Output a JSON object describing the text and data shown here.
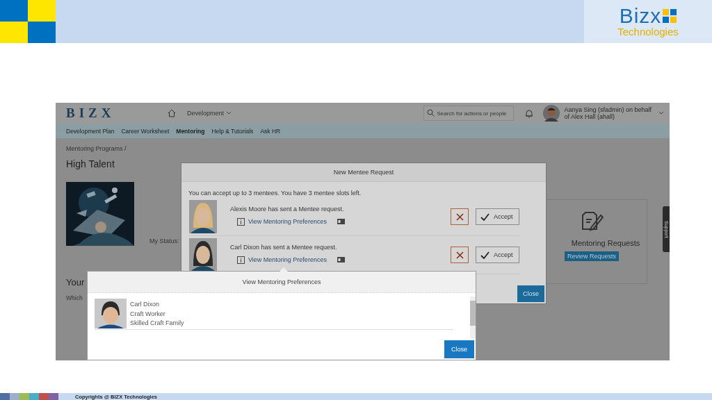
{
  "slide": {
    "logo": {
      "name": "Bizx",
      "tagline": "Technologies"
    },
    "footer": "Copyrights @ BIZX Technologies"
  },
  "app": {
    "logo": "BIZX",
    "module": "Development",
    "search": {
      "placeholder": "Search for actions or people"
    },
    "user": [
      "Aanya Sing (sfadmin) on behalf",
      "of Alex Hall (ahall)"
    ],
    "nav": [
      {
        "label": "Development Plan",
        "selected": false
      },
      {
        "label": "Career Worksheet",
        "selected": false
      },
      {
        "label": "Mentoring",
        "selected": true
      },
      {
        "label": "Help & Tutorials",
        "selected": false
      },
      {
        "label": "Ask HR",
        "selected": false
      }
    ],
    "breadcrumb": "Mentoring Programs /",
    "title": "High Talent",
    "status_label": "My Status:",
    "section_heading": "Your",
    "section_text": "Which",
    "card": {
      "title": "Mentoring Requests",
      "button": "Review Requests"
    },
    "side_tab": "Support"
  },
  "mentee_dialog": {
    "title": "New Mentee Request",
    "intro": "You can accept up to 3 mentees. You have 3 mentee slots left.",
    "requests": [
      {
        "message": "Alexis Moore has sent a Mentee request.",
        "link": "View Mentoring Preferences",
        "accept": "Accept"
      },
      {
        "message": "Carl Dixon has sent a Mentee request.",
        "link": "View Mentoring Preferences",
        "accept": "Accept"
      }
    ],
    "close": "Close"
  },
  "preferences_dialog": {
    "title": "View Mentoring Preferences",
    "person": [
      "Carl Dixon",
      "Craft Worker",
      "Skilled Craft Family"
    ],
    "close": "Close"
  }
}
